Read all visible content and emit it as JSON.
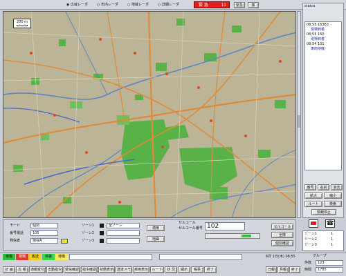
{
  "top_bar": {
    "radios": [
      "広域レーダ",
      "市内レーダ",
      "地域レーダ",
      "詳細レーダ"
    ],
    "alert_text": "緊 急",
    "alert_count": "11",
    "btn_a": "緊急",
    "btn_b": "隊"
  },
  "map": {
    "scale_label": "200 m",
    "colors": {
      "water": "#5a86c6",
      "road": "#e08a38",
      "park": "#58b248",
      "base": "#b9b293"
    }
  },
  "right_panel": {
    "title": "status",
    "log": [
      {
        "time": "08:55",
        "code": "16383",
        "text": "現場到着"
      },
      {
        "time": "08:55",
        "code": "150",
        "text": "現場到着"
      },
      {
        "time": "08:54",
        "code": "101",
        "text": "車両待機"
      }
    ],
    "buttons": [
      [
        "番号",
        "名前",
        "消去"
      ],
      [
        "拡大",
        "縮小",
        ""
      ],
      [
        "ルート",
        "検索",
        ""
      ],
      [
        "情報停止",
        "",
        ""
      ]
    ]
  },
  "form": {
    "mode_label": "モード",
    "mode_value": "個別",
    "code_label": "番号電話",
    "code_value": "105",
    "name_label": "発信者",
    "name_value": "現在A",
    "zone1_label": "ゾーン1",
    "zone1_value": "全ゾーン",
    "zone2_label": "ゾーン2",
    "zone3_label": "ゾーン3",
    "apply_button": "適用",
    "area_button": "地図",
    "unit_label": "セルコール",
    "unit_sub_label": "セルコール番号",
    "unit_value": "102",
    "send_button": "セルコール",
    "all_button": "全隊",
    "indiv_button": "個別確認"
  },
  "bottom_right": {
    "group_title": "グループ",
    "rows": [
      {
        "label": "ゾーン1",
        "value": "1"
      },
      {
        "label": "ゾーン2",
        "value": "1"
      },
      {
        "label": "ゾーン3",
        "value": "1"
      }
    ],
    "count_label": "件数",
    "count_value": "123",
    "time_label": "時間",
    "time_value": "1785"
  },
  "status_bar": {
    "tags": [
      {
        "label": "稼働",
        "color": "#2fbf3a"
      },
      {
        "label": "現場",
        "color": "#e03a2a"
      },
      {
        "label": "搬送",
        "color": "#f0d018"
      },
      {
        "label": "帰署",
        "color": "#38d848"
      },
      {
        "label": "待機",
        "color": "#f7e85a"
      }
    ],
    "datetime": "6月 1日(木) 08:55"
  },
  "bottom_buttons": [
    "計 画",
    "広 報",
    "通報受付",
    "出動指令",
    "受信確認",
    "指令確認",
    "状態表示",
    "送達メモ",
    "車両表示",
    "ルート",
    "状 況",
    "開示",
    "帳票",
    "終了"
  ],
  "side_buttons": [
    "日報",
    "月報",
    "終了"
  ]
}
